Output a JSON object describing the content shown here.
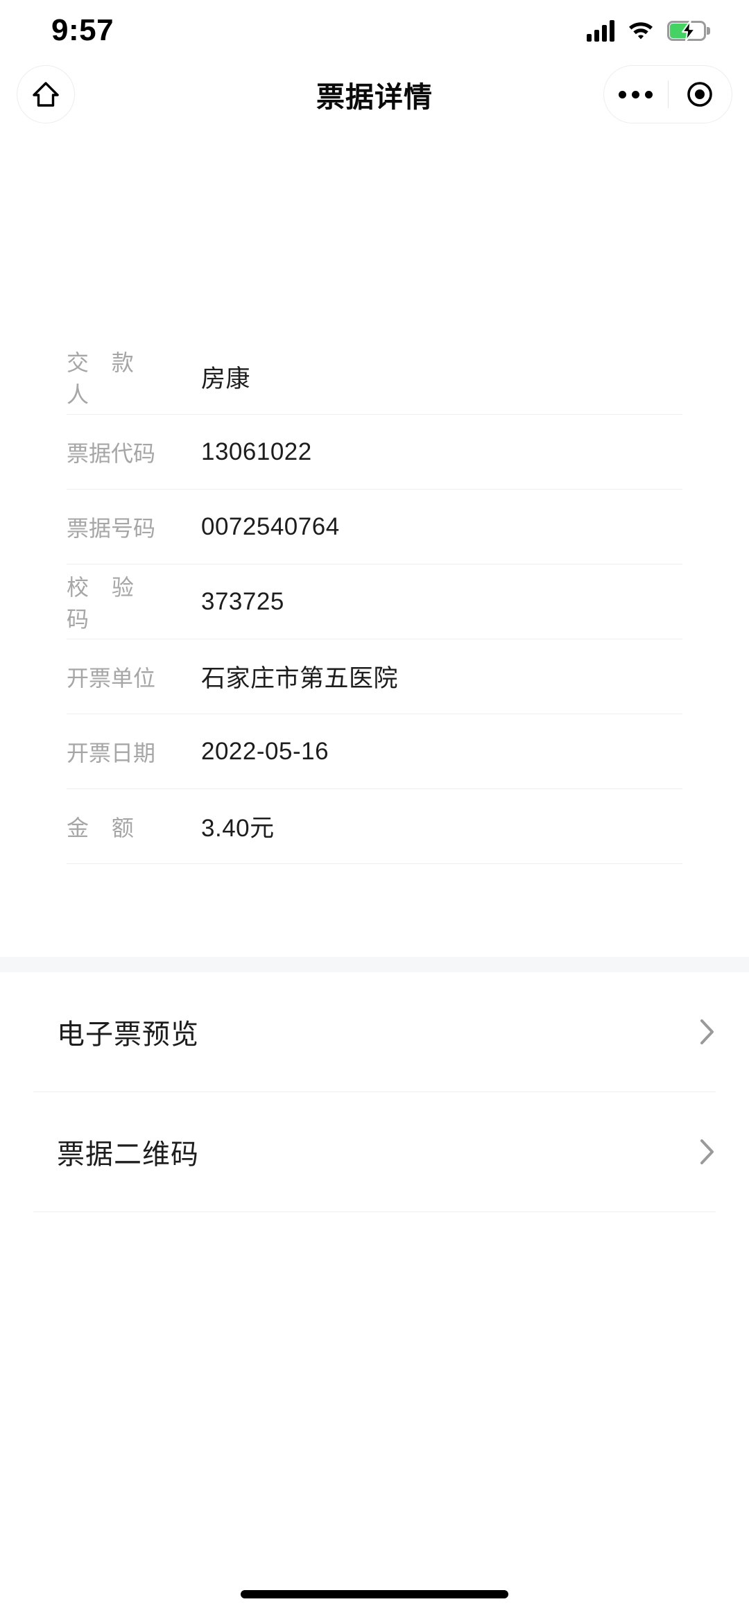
{
  "status_bar": {
    "time": "9:57",
    "signal_icon": "signal-bars-icon",
    "wifi_icon": "wifi-icon",
    "battery_icon": "battery-charging-icon",
    "battery_charging": true
  },
  "nav_bar": {
    "title": "票据详情",
    "home_button_icon": "home-icon",
    "capsule": {
      "more_icon": "more-dots-icon",
      "target_icon": "target-circle-icon"
    }
  },
  "detail": {
    "rows": [
      {
        "label": "交 款 人",
        "value": "房康"
      },
      {
        "label": "票据代码",
        "value": "13061022"
      },
      {
        "label": "票据号码",
        "value": "0072540764"
      },
      {
        "label": "校 验 码",
        "value": "373725"
      },
      {
        "label": "开票单位",
        "value": "石家庄市第五医院"
      },
      {
        "label": "开票日期",
        "value": "2022-05-16"
      },
      {
        "label": "金 额",
        "value": "3.40元"
      }
    ]
  },
  "actions": {
    "items": [
      {
        "label": "电子票预览",
        "chevron_icon": "chevron-right-icon"
      },
      {
        "label": "票据二维码",
        "chevron_icon": "chevron-right-icon"
      }
    ]
  },
  "colors": {
    "label_gray": "#a6a6a6",
    "value_black": "#1d1d1d",
    "divider": "#efefef",
    "band_gray": "#f6f7f9",
    "battery_green": "#44d362",
    "chevron_gray": "#9a9a9a"
  }
}
